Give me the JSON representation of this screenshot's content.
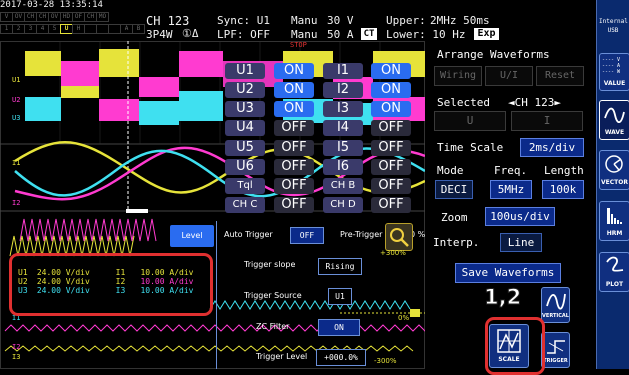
{
  "header": {
    "datetime": "2017-03-28 13:35:14",
    "channel": "CH 123",
    "wiring": "3P4W",
    "wiring_marks": "①Δ",
    "sync": "Sync: U1",
    "lpf": "LPF: OFF",
    "manu1": "Manu",
    "manu1_val": "30 V",
    "manu2": "Manu",
    "manu2_val": "50 A",
    "ct_badge": "CT",
    "upper": "Upper:",
    "upper_val": "2MHz  50ms",
    "lower": "Lower: 10 Hz",
    "exp_badge": "Exp",
    "indicators_row1": [
      "V↑",
      "OV",
      "CH",
      "CH",
      "OVR",
      "HOLD",
      "OFF",
      "CHG",
      "MOT"
    ],
    "indicators_row2": [
      "1",
      "2",
      "3",
      "4",
      "5",
      "6",
      "U",
      "HRM",
      "",
      "",
      "",
      "",
      "A",
      "B"
    ],
    "u_mark": "U"
  },
  "sidebar": {
    "storage_line1": "Internal",
    "storage_line2": "USB",
    "value_label": "VALUE",
    "wave_label": "WAVE",
    "vector_label": "VECTOR",
    "hrm_label": "HRM",
    "plot_label": "PLOT",
    "value_lines": [
      "---- V",
      "---- A",
      "---- W"
    ]
  },
  "wave": {
    "stop": "STOP",
    "labels_top": [
      "U1",
      "U2",
      "U3"
    ],
    "labels_mid": [
      "I1",
      "I2"
    ],
    "labels_bot": [
      "I1",
      "I2",
      "I3"
    ],
    "channel_grid": [
      {
        "name": "U1",
        "state": "ON",
        "name2": "I1",
        "state2": "ON"
      },
      {
        "name": "U2",
        "state": "ON",
        "name2": "I2",
        "state2": "ON"
      },
      {
        "name": "U3",
        "state": "ON",
        "name2": "I3",
        "state2": "ON"
      },
      {
        "name": "U4",
        "state": "OFF",
        "name2": "I4",
        "state2": "OFF"
      },
      {
        "name": "U5",
        "state": "OFF",
        "name2": "I5",
        "state2": "OFF"
      },
      {
        "name": "U6",
        "state": "OFF",
        "name2": "I6",
        "state2": "OFF"
      },
      {
        "name": "Tql",
        "state": "OFF",
        "name2": "CH B",
        "state2": "OFF"
      },
      {
        "name": "CH C",
        "state": "OFF",
        "name2": "CH D",
        "state2": "OFF"
      }
    ]
  },
  "scale_settings": {
    "rows": [
      {
        "u": "U1",
        "u_val": "24.00 V/div",
        "i": "I1",
        "i_val": "10.00 A/div"
      },
      {
        "u": "U2",
        "u_val": "24.00 V/div",
        "i": "I2",
        "i_val": "10.00 A/div"
      },
      {
        "u": "U3",
        "u_val": "24.00 V/div",
        "i": "I3",
        "i_val": "10.00 A/div"
      }
    ]
  },
  "trigger": {
    "level_tab": "Level",
    "auto_trigger": "Auto Trigger",
    "auto_trigger_val": "OFF",
    "pre_trigger": "Pre-Trigger",
    "pre_trigger_val": "0 %",
    "slope": "Trigger slope",
    "slope_val": "Rising",
    "source": "Trigger Source",
    "source_val": "U1",
    "zc_filter": "ZC Filter",
    "zc_filter_val": "ON",
    "level": "Trigger Level",
    "level_val": "+000.0%",
    "pct_top": "+300%",
    "pct_mid": "0%",
    "pct_bot": "-300%"
  },
  "right_panel": {
    "arrange_title": "Arrange Waveforms",
    "wiring_btn": "Wiring",
    "ui_btn": "U/I",
    "reset_btn": "Reset",
    "selected_label": "Selected",
    "selected_val": "◄CH 123►",
    "u_btn": "U",
    "i_btn": "I",
    "time_scale": "Time Scale",
    "time_scale_val": "2ms/div",
    "mode": "Mode",
    "freq": "Freq.",
    "length": "Length",
    "mode_val": "DECI",
    "freq_val": "5MHz",
    "length_val": "100k",
    "zoom": "Zoom",
    "zoom_val": "100us/div",
    "interp": "Interp.",
    "interp_val": "Line",
    "save_btn": "Save Waveforms",
    "vertical_label": "VERTICAL",
    "scale_label": "SCALE",
    "trigger_label": "TRIGGER"
  },
  "callout": {
    "step": "1,2"
  },
  "colors": {
    "u1": "#e6e33a",
    "u2": "#ff3bd0",
    "u3": "#3fe0f0",
    "accent": "#2a6cf0",
    "callout": "#e03030"
  }
}
